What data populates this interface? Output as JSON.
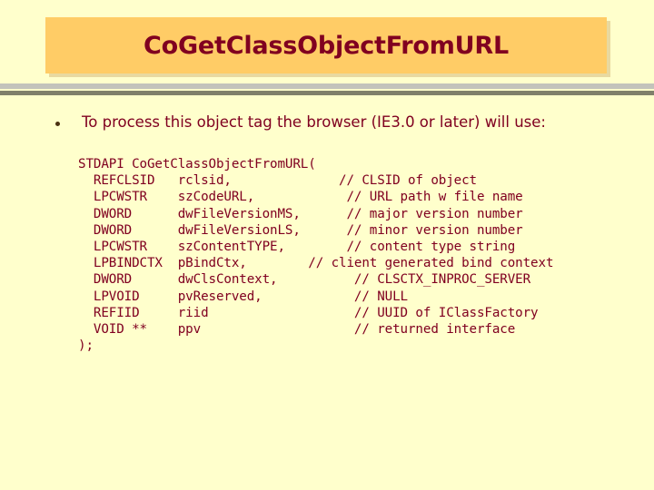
{
  "slide": {
    "background_color": "#ffffcc",
    "title": {
      "text": "CoGetClassObjectFromURL",
      "box_color": "#ffcc66",
      "text_color": "#800020"
    },
    "rules": {
      "light_color": "#c3c3bb",
      "dark_color": "#80806a"
    },
    "bullet": {
      "marker": "bullet-dot",
      "text": "To process this object tag the browser (IE3.0 or later) will use:"
    },
    "code": {
      "lines": [
        "STDAPI CoGetClassObjectFromURL(",
        "  REFCLSID   rclsid,              // CLSID of object",
        "  LPCWSTR    szCodeURL,            // URL path w file name",
        "  DWORD      dwFileVersionMS,      // major version number",
        "  DWORD      dwFileVersionLS,      // minor version number",
        "  LPCWSTR    szContentTYPE,        // content type string",
        "  LPBINDCTX  pBindCtx,        // client generated bind context",
        "  DWORD      dwClsContext,          // CLSCTX_INPROC_SERVER",
        "  LPVOID     pvReserved,            // NULL",
        "  REFIID     riid                   // UUID of IClassFactory",
        "  VOID **    ppv                    // returned interface",
        ");"
      ]
    }
  }
}
